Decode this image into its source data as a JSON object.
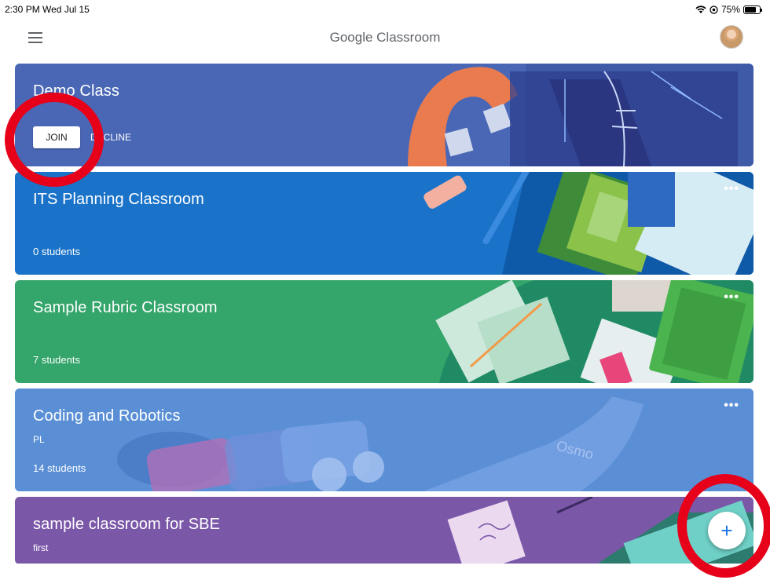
{
  "status_bar": {
    "time": "2:30 PM  Wed Jul 15",
    "battery": "75%",
    "wifi_icon": "wifi-icon",
    "location_icon": "location-icon"
  },
  "app_bar": {
    "title": "Google Classroom",
    "menu_icon": "hamburger-menu-icon",
    "avatar_icon": "user-avatar"
  },
  "classes": [
    {
      "name": "Demo Class",
      "section": "",
      "students": "",
      "join_label": "JOIN",
      "decline_label": "DECLINE",
      "color": "#4a67b6"
    },
    {
      "name": "ITS Planning Classroom",
      "section": "",
      "students": "0 students",
      "color": "#1a73c8"
    },
    {
      "name": "Sample Rubric Classroom",
      "section": "",
      "students": "7 students",
      "color": "#34a56b"
    },
    {
      "name": "Coding and Robotics",
      "section": "PL",
      "students": "14 students",
      "color": "#5a8fd6"
    },
    {
      "name": "sample classroom for SBE",
      "section": "first",
      "students": "",
      "color": "#7b57a8"
    }
  ],
  "more_label": "•••",
  "fab": {
    "label": "+",
    "icon": "plus-icon"
  },
  "annotation_color": "#e6001a"
}
